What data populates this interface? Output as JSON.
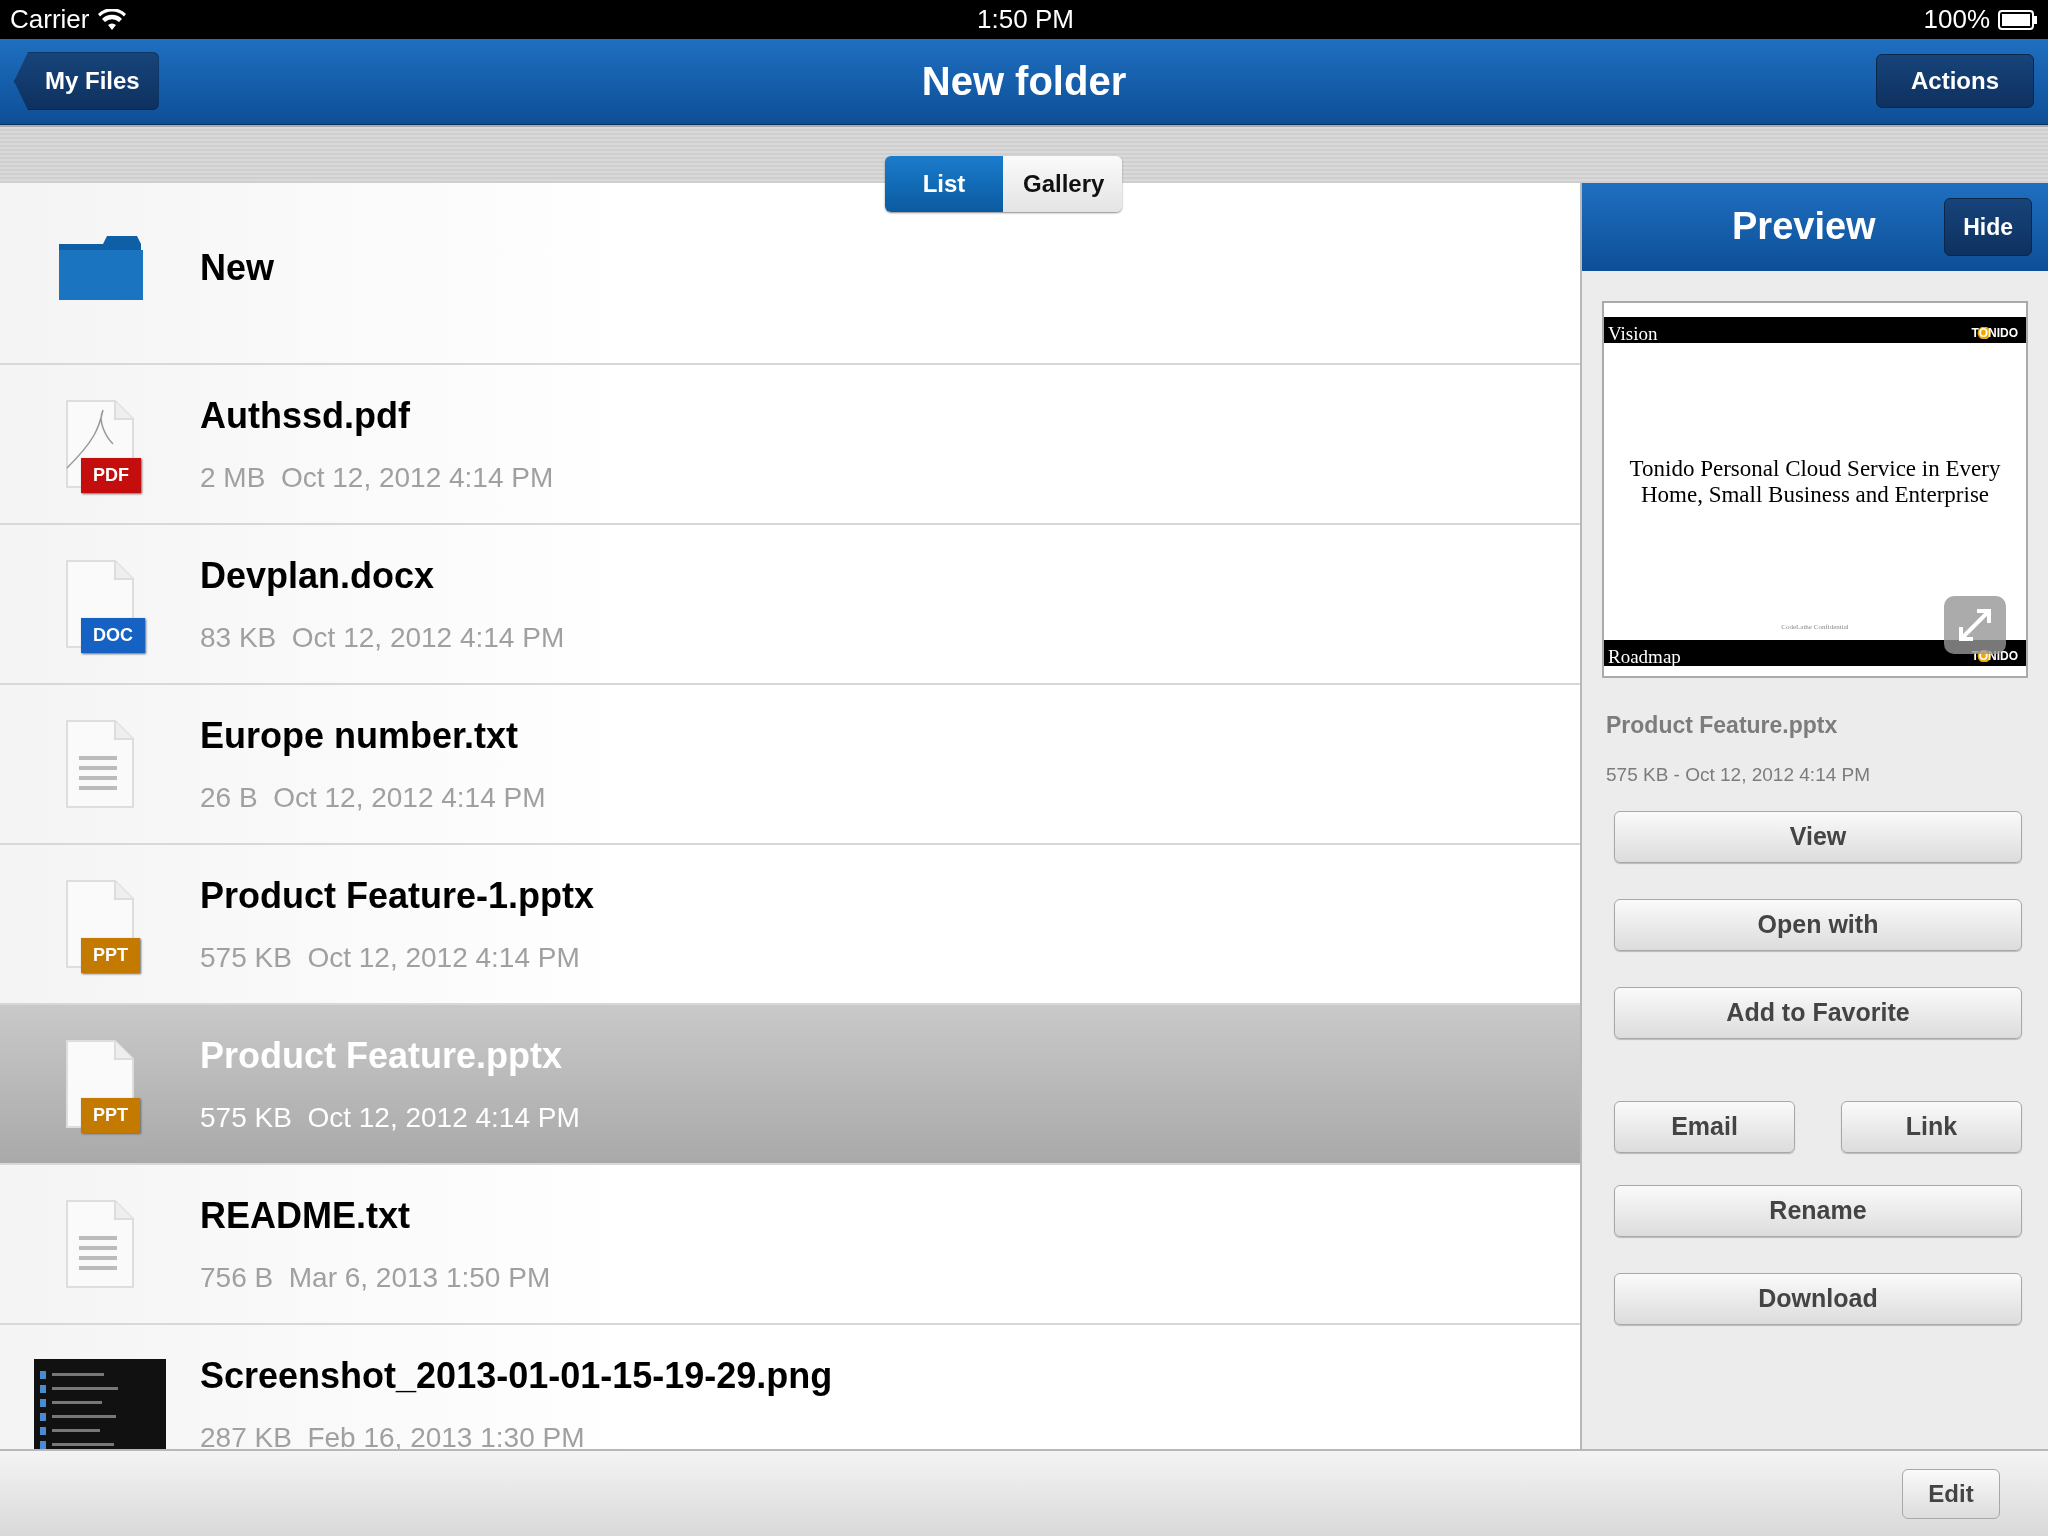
{
  "status_bar": {
    "carrier": "Carrier",
    "time": "1:50 PM",
    "battery": "100%"
  },
  "nav_bar": {
    "back": "My Files",
    "title": "New folder",
    "action": "Actions"
  },
  "view_toggle": [
    {
      "label": "List",
      "selected": true
    },
    {
      "label": "Gallery",
      "selected": false
    }
  ],
  "files": [
    {
      "kind": "folder",
      "name": "New",
      "selected": false
    },
    {
      "kind": "pdf",
      "badge": "PDF",
      "name": "Authssd.pdf",
      "size": "2 MB",
      "date": "Oct 12, 2012 4:14 PM",
      "selected": false
    },
    {
      "kind": "doc",
      "badge": "DOC",
      "name": "Devplan.docx",
      "size": "83 KB",
      "date": "Oct 12, 2012 4:14 PM",
      "selected": false
    },
    {
      "kind": "txt",
      "name": "Europe number.txt",
      "size": "26 B",
      "date": "Oct 12, 2012 4:14 PM",
      "selected": false
    },
    {
      "kind": "ppt",
      "badge": "PPT",
      "name": "Product Feature-1.pptx",
      "size": "575 KB",
      "date": "Oct 12, 2012 4:14 PM",
      "selected": false
    },
    {
      "kind": "ppt",
      "badge": "PPT",
      "name": "Product Feature.pptx",
      "size": "575 KB",
      "date": "Oct 12, 2012 4:14 PM",
      "selected": true
    },
    {
      "kind": "txt",
      "name": "README.txt",
      "size": "756 B",
      "date": "Mar 6, 2013 1:50 PM",
      "selected": false
    },
    {
      "kind": "image",
      "name": "Screenshot_2013-01-01-15-19-29.png",
      "size": "287 KB",
      "date": "Feb 16, 2013 1:30 PM",
      "selected": false
    }
  ],
  "preview": {
    "title": "Preview",
    "hide": "Hide",
    "slide": {
      "title": "Vision",
      "logo": "TONIDO",
      "body": "Tonido Personal Cloud Service in Every Home, Small Business and Enterprise",
      "footer": "CodeLathe Confidential",
      "next_title": "Roadmap",
      "next_logo": "TONIDO"
    },
    "file_name": "Product Feature.pptx",
    "file_meta": "575 KB - Oct 12, 2012 4:14 PM",
    "actions": [
      {
        "label": "View",
        "kind": "wide"
      },
      {
        "label": "Open with",
        "kind": "wide"
      },
      {
        "label": "Add to Favorite",
        "kind": "wide"
      },
      {
        "label": "Email",
        "kind": "half"
      },
      {
        "label": "Link",
        "kind": "half"
      },
      {
        "label": "Rename",
        "kind": "wide"
      },
      {
        "label": "Download",
        "kind": "wide"
      }
    ]
  },
  "toolbar": {
    "edit": "Edit"
  }
}
